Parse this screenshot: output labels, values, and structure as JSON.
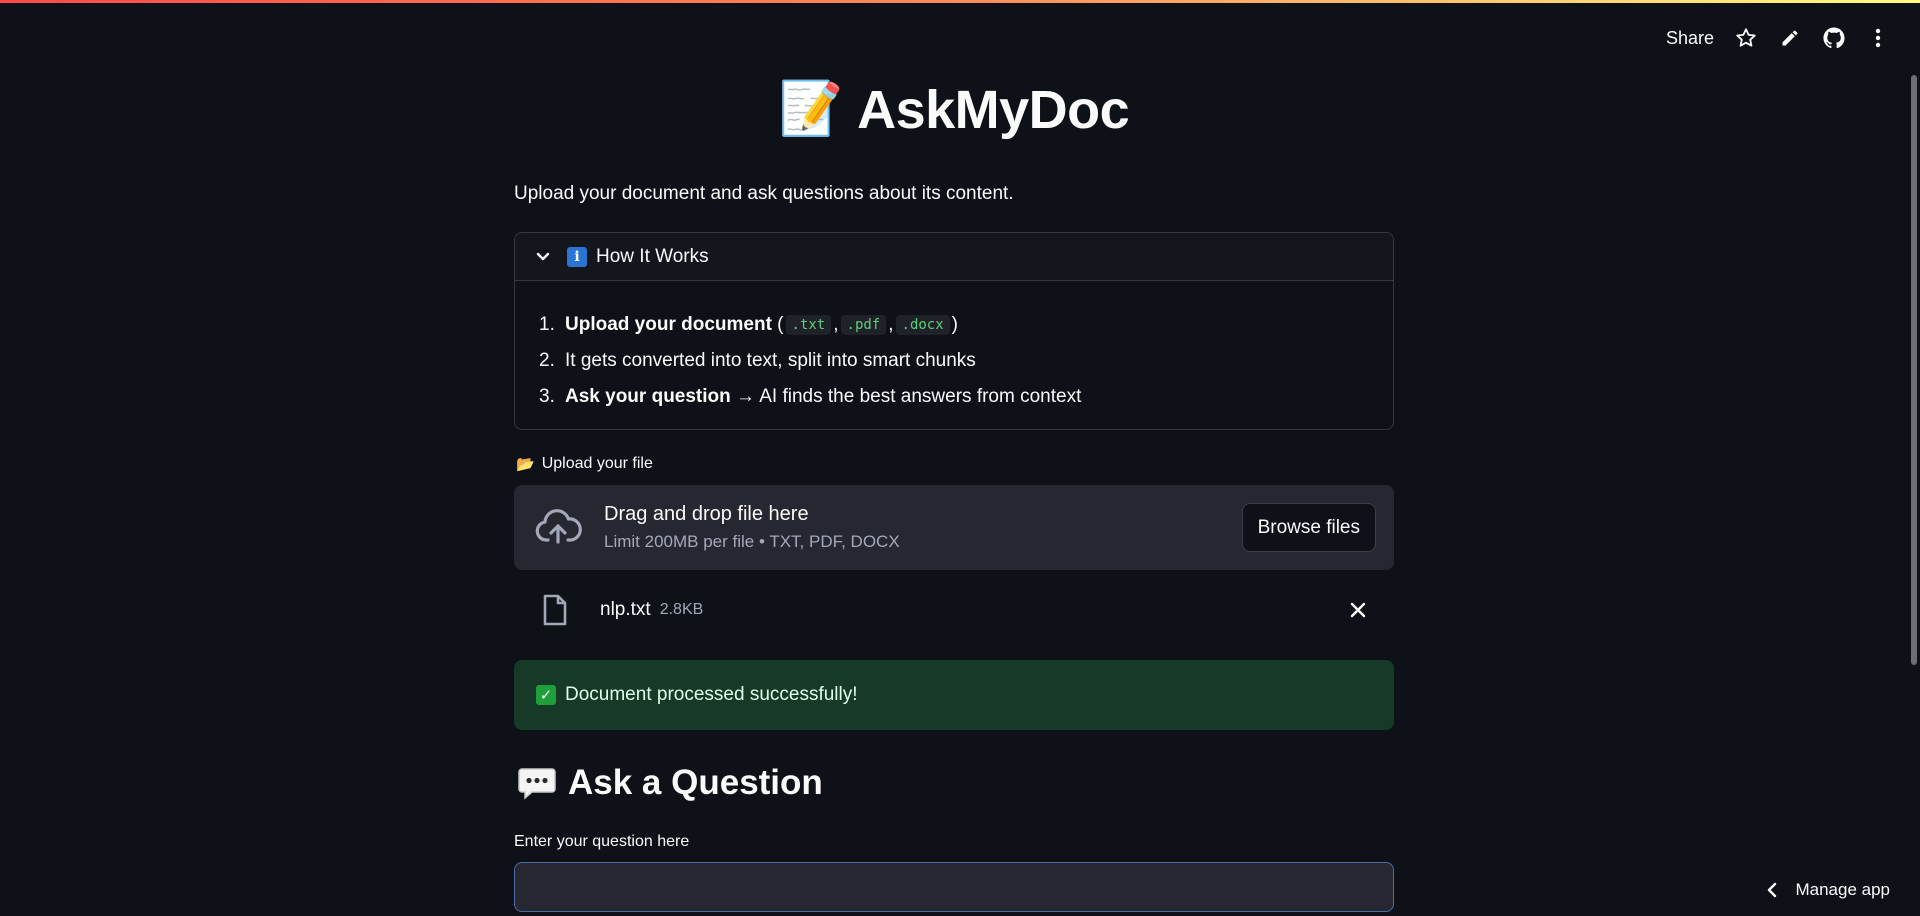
{
  "toolbar": {
    "share_label": "Share",
    "icons": [
      "star-icon",
      "pencil-icon",
      "github-icon",
      "more-vertical-icon"
    ]
  },
  "header": {
    "emoji": "📝",
    "title": "AskMyDoc",
    "subtitle": "Upload your document and ask questions about its content."
  },
  "expander": {
    "info_icon": "i",
    "title": "How It Works",
    "steps": [
      {
        "num": "1.",
        "bold": "Upload your document",
        "open": " (",
        "tags": [
          ".txt",
          ".pdf",
          ".docx"
        ],
        "close": ")"
      },
      {
        "num": "2.",
        "text": "It gets converted into text, split into smart chunks"
      },
      {
        "num": "3.",
        "bold": "Ask your question",
        "text": " → AI finds the best answers from context"
      }
    ]
  },
  "uploader": {
    "label_icon": "📂",
    "label": "Upload your file",
    "drop_text": "Drag and drop file here",
    "limit_text": "Limit 200MB per file • TXT, PDF, DOCX",
    "browse_label": "Browse files",
    "file": {
      "name": "nlp.txt",
      "size": "2.8KB"
    }
  },
  "status": {
    "success_icon": "✓",
    "success_text": "Document processed successfully!"
  },
  "question": {
    "heading": "Ask a Question",
    "label": "Enter your question here",
    "value": ""
  },
  "footer": {
    "manage_label": "Manage app"
  },
  "colors": {
    "background": "#0e1117",
    "accent_bar": [
      "#ff4b4b",
      "#fffd80"
    ],
    "success_bg": "#173928",
    "code_green": "#5ccf7a"
  }
}
